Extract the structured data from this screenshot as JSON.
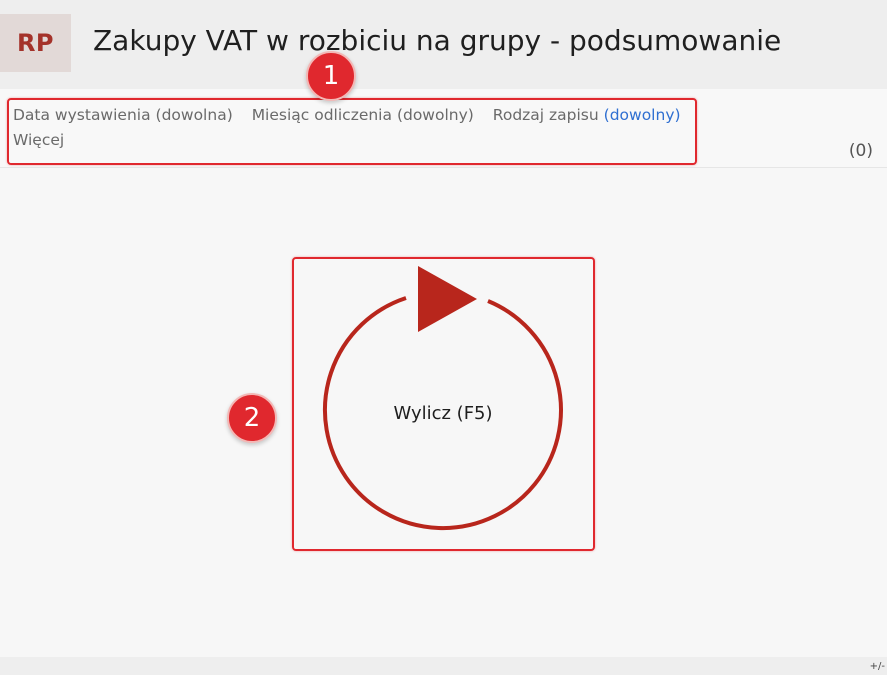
{
  "header": {
    "badge": "RP",
    "title": "Zakupy VAT w rozbiciu na grupy - podsumowanie"
  },
  "filters": {
    "items": [
      {
        "label": "Data wystawienia",
        "value": "(dowolna)"
      },
      {
        "label": "Miesiąc odliczenia",
        "value": "(dowolny)"
      },
      {
        "label": "Rodzaj zapisu",
        "value": "(dowolny)"
      }
    ],
    "more": "Więcej",
    "count": "(0)"
  },
  "main": {
    "calculate_label": "Wylicz (F5)",
    "calculate_icon": "refresh-arrow-icon"
  },
  "annotations": [
    {
      "number": "1"
    },
    {
      "number": "2"
    }
  ],
  "footer": {
    "toggle": "+/-"
  },
  "colors": {
    "accent": "#a4322a",
    "circle": "#b8261c",
    "link": "#2f6fd1",
    "annotation": "#e0282e"
  }
}
